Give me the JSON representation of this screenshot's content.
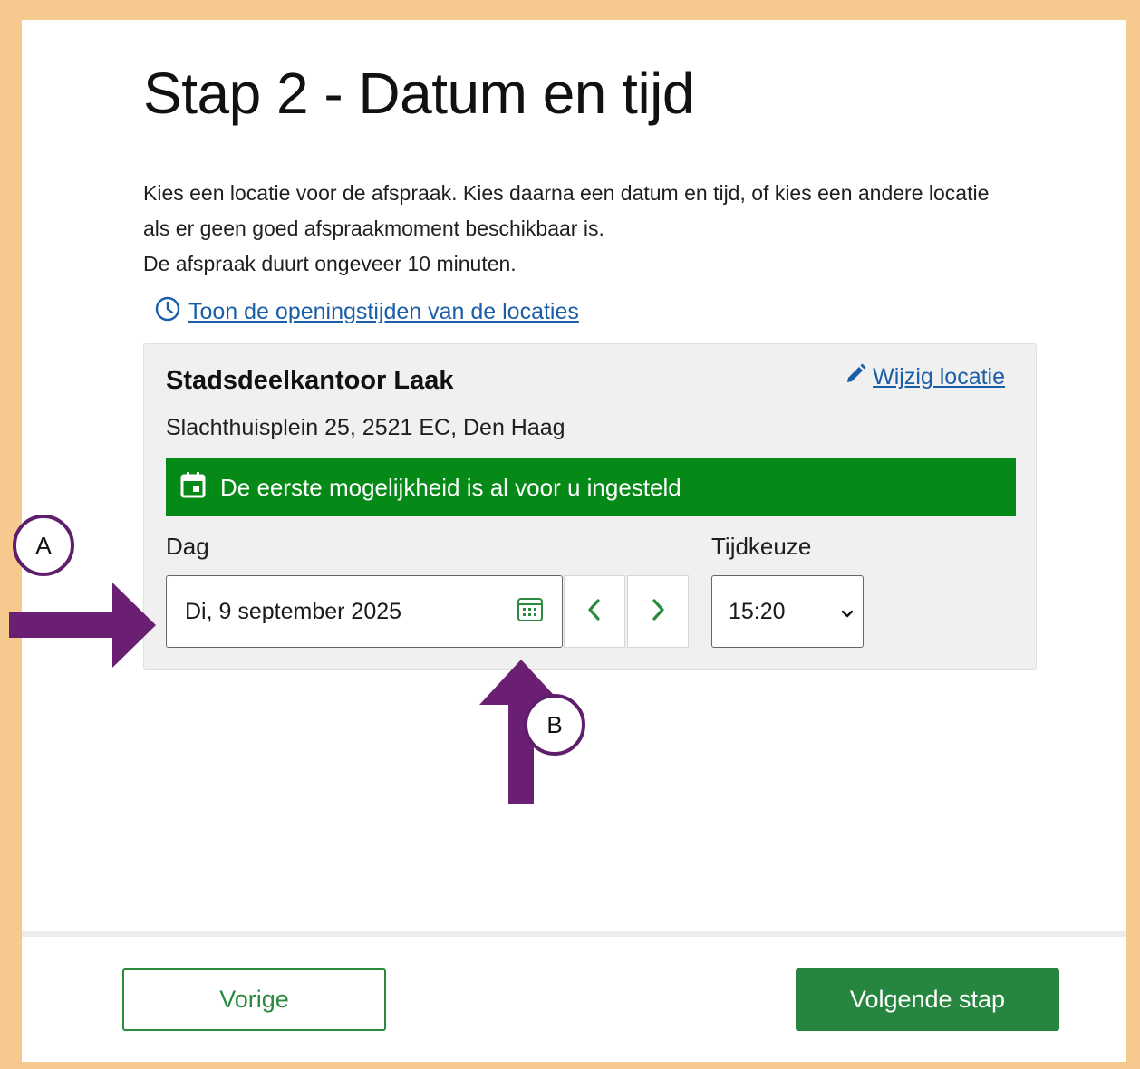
{
  "page": {
    "title": "Stap 2 - Datum en tijd",
    "intro_line1": "Kies een locatie voor de afspraak. Kies daarna een datum en tijd, of kies een andere locatie als er geen goed afspraakmoment beschikbaar is.",
    "intro_line2": "De afspraak duurt ongeveer 10 minuten.",
    "hours_link": "Toon de openingstijden van de locaties"
  },
  "location": {
    "name": "Stadsdeelkantoor Laak",
    "change_link": "Wijzig locatie",
    "address": "Slachthuisplein 25, 2521 EC, Den Haag",
    "notice": "De eerste mogelijkheid is al voor u ingesteld"
  },
  "form": {
    "day_label": "Dag",
    "day_value": "Di, 9 september 2025",
    "time_label": "Tijdkeuze",
    "time_value": "15:20"
  },
  "footer": {
    "prev_label": "Vorige",
    "next_label": "Volgende stap"
  },
  "annotations": {
    "marker_a": "A",
    "marker_b": "B"
  },
  "colors": {
    "frame": "#f6c98f",
    "accent_green": "#058917",
    "button_green": "#26853e",
    "link_blue": "#1a5ea8",
    "annotation_purple": "#6b1f73"
  },
  "icons": {
    "hours": "clock-icon",
    "change": "pencil-icon",
    "notice": "calendar-icon",
    "date_picker": "calendar-grid-icon",
    "prev_day": "chevron-left-icon",
    "next_day": "chevron-right-icon",
    "select": "chevron-down-icon"
  }
}
